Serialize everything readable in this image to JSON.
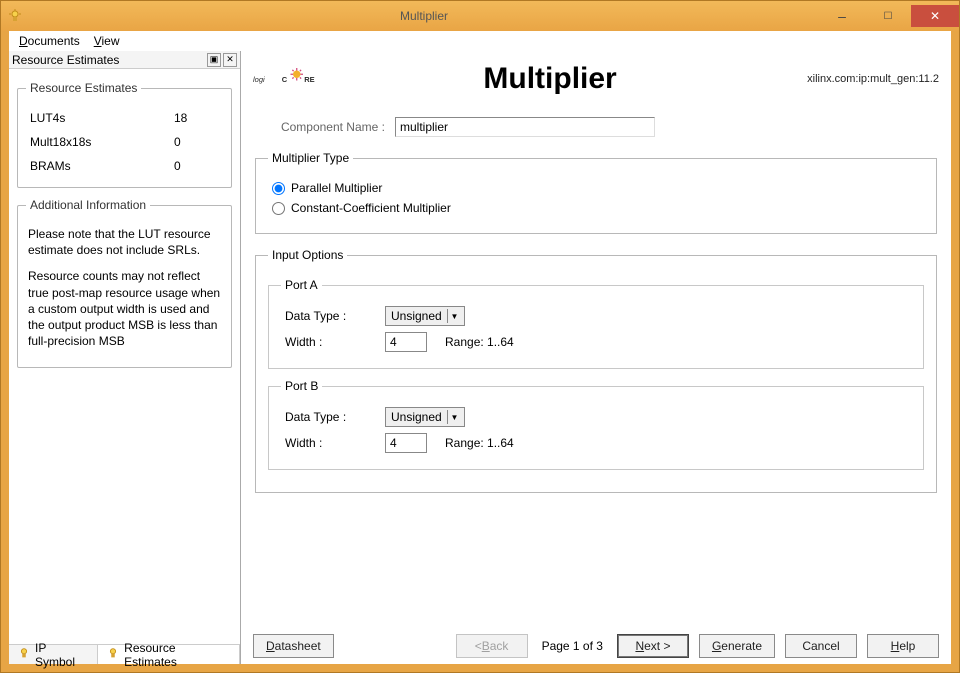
{
  "window": {
    "title": "Multiplier"
  },
  "menu": {
    "documents": "Documents",
    "view": "View"
  },
  "panel": {
    "title": "Resource Estimates",
    "estimates": {
      "legend": "Resource Estimates",
      "rows": [
        {
          "name": "LUT4s",
          "value": "18"
        },
        {
          "name": "Mult18x18s",
          "value": "0"
        },
        {
          "name": "BRAMs",
          "value": "0"
        }
      ]
    },
    "addinfo": {
      "legend": "Additional Information",
      "p1": "Please note that the LUT resource estimate does not include SRLs.",
      "p2": "Resource counts may not reflect true post-map resource usage when a custom output width is used and the output product MSB is less than full-precision MSB"
    },
    "tabs": {
      "ip_symbol": "IP Symbol",
      "res_est": "Resource Estimates"
    }
  },
  "main": {
    "title": "Multiplier",
    "ip_string": "xilinx.com:ip:mult_gen:11.2",
    "component_name_label": "Component Name :",
    "component_name_value": "multiplier",
    "mult_type": {
      "legend": "Multiplier Type",
      "parallel": "Parallel Multiplier",
      "constcoef": "Constant-Coefficient Multiplier",
      "selected": "parallel"
    },
    "input_options": {
      "legend": "Input Options",
      "port_a": {
        "legend": "Port A",
        "data_type_label": "Data Type :",
        "data_type_value": "Unsigned",
        "width_label": "Width :",
        "width_value": "4",
        "range_label": "Range: 1..64"
      },
      "port_b": {
        "legend": "Port B",
        "data_type_label": "Data Type :",
        "data_type_value": "Unsigned",
        "width_label": "Width :",
        "width_value": "4",
        "range_label": "Range: 1..64"
      }
    },
    "footer": {
      "datasheet": "Datasheet",
      "back": "< Back",
      "page": "Page 1 of 3",
      "next": "Next >",
      "generate": "Generate",
      "cancel": "Cancel",
      "help": "Help"
    }
  }
}
